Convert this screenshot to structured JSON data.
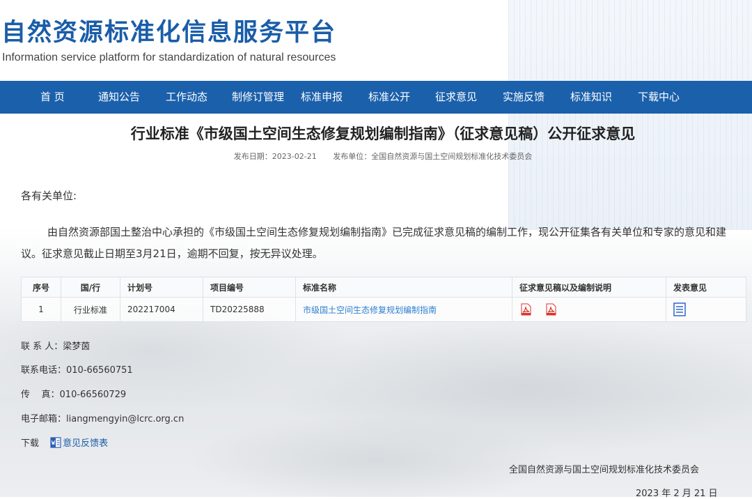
{
  "header": {
    "title_cn": "自然资源标准化信息服务平台",
    "title_en": "Information service platform for standardization of natural resources"
  },
  "nav": {
    "items": [
      "首 页",
      "通知公告",
      "工作动态",
      "制修订管理",
      "标准申报",
      "标准公开",
      "征求意见",
      "实施反馈",
      "标准知识",
      "下载中心"
    ]
  },
  "article": {
    "title": "行业标准《市级国土空间生态修复规划编制指南》（征求意见稿）公开征求意见",
    "publish_date": "发布日期：2023-02-21",
    "publisher": "发布单位：全国自然资源与国土空间规划标准化技术委员会",
    "greeting": "各有关单位:",
    "paragraph": "由自然资源部国土整治中心承担的《市级国土空间生态修复规划编制指南》已完成征求意见稿的编制工作，现公开征集各有关单位和专家的意见和建议。征求意见截止日期至3月21日，逾期不回复，按无异议处理。"
  },
  "table": {
    "headers": [
      "序号",
      "国/行",
      "计划号",
      "项目编号",
      "标准名称",
      "征求意见稿以及编制说明",
      "发表意见"
    ],
    "row": {
      "index": "1",
      "level": "行业标准",
      "plan_no": "202217004",
      "project_no": "TD20225888",
      "name": "市级国土空间生态修复规划编制指南"
    }
  },
  "contact": {
    "person": "联 系 人：梁梦茵",
    "phone": "联系电话：010-66560751",
    "fax": "传    真：010-66560729",
    "email": "电子邮箱：liangmengyin@lcrc.org.cn",
    "download_label": "下载",
    "download_link": "意见反馈表"
  },
  "signature": {
    "org": "全国自然资源与国土空间规划标准化技术委员会",
    "date": "2023 年 2 月 21 日"
  },
  "colors": {
    "brand": "#1b60ab",
    "title_blue": "#1a5da8",
    "link": "#2d7fd0",
    "pdf_red": "#d9352b"
  },
  "icons": [
    "pdf-icon",
    "document-icon",
    "word-icon"
  ]
}
